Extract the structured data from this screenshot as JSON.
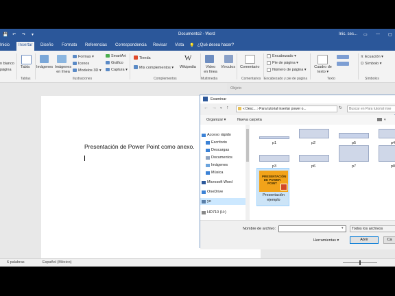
{
  "app": {
    "quick_access": [
      "💾",
      "↶",
      "↷"
    ],
    "doc_title": "Documento2 - Word",
    "user": "Inic. ses...",
    "window_buttons": [
      "▭",
      "—",
      "▢"
    ]
  },
  "tabs": [
    "Inicio",
    "Insertar",
    "Diseño",
    "Formato",
    "Referencias",
    "Correspondencia",
    "Revisar",
    "Vista",
    "¿Qué desea hacer?"
  ],
  "ribbon": {
    "pages_left": [
      "n blanco",
      "página"
    ],
    "table": "Tabla",
    "images": "Imágenes",
    "online_images": "Imágenes en línea",
    "shapes": "Formas ▾",
    "icons": "Iconos",
    "models3d": "Modelos 3D ▾",
    "smartart": "SmartArt",
    "chart": "Gráfico",
    "screenshot": "Captura ▾",
    "store": "Tienda",
    "my_addins": "Mis complementos ▾",
    "wikipedia": "Wikipedia",
    "video": "Vídeo en línea",
    "links": "Vínculos",
    "comment": "Comentario",
    "header": "Encabezado ▾",
    "footer": "Pie de página ▾",
    "page_number": "Número de página ▾",
    "textbox": "Cuadro de texto ▾",
    "equation": "Ecuación ▾",
    "symbol": "Símbolo ▾",
    "groups": {
      "pages": "Tablas",
      "tables": "Tablas",
      "illustrations": "Ilustraciones",
      "addins": "Complementos",
      "media": "Multimedia",
      "comments": "Comentarios",
      "header_footer": "Encabezado y pie de página",
      "text": "Texto",
      "symbols": "Símbolos"
    }
  },
  "document": {
    "line1": "Presentación de Power Point como anexo.",
    "objeto": "Objeto"
  },
  "status": {
    "words": "6 palabras",
    "lang": "Español (México)"
  },
  "dialog": {
    "title": "Examinar",
    "breadcrumb": "« Desc... › Para tutorial insertar power o...",
    "search_placeholder": "Buscar en Para tutorial inse",
    "organize": "Organizar ▾",
    "new_folder": "Nueva carpeta",
    "nav": [
      {
        "label": "Acceso rápido",
        "icon": "star-icon"
      },
      {
        "label": "Escritorio",
        "icon": "desktop-icon"
      },
      {
        "label": "Descargas",
        "icon": "download-icon"
      },
      {
        "label": "Documentos",
        "icon": "documents-icon"
      },
      {
        "label": "Imágenes",
        "icon": "pictures-icon"
      },
      {
        "label": "Música",
        "icon": "music-icon"
      },
      {
        "label": "Microsoft Word",
        "icon": "word-icon"
      },
      {
        "label": "OneDrive",
        "icon": "cloud-icon"
      },
      {
        "label": "yo",
        "icon": "pc-icon"
      },
      {
        "label": "HD710 (H:)",
        "icon": "drive-icon"
      }
    ],
    "files": [
      "p1",
      "p2",
      "p5",
      "p4",
      "p3",
      "p6",
      "p7",
      "p8",
      "Presentación ejemplo"
    ],
    "ppt_thumb_text": "PRESENTACIÓN DE POWER POINT",
    "filename_label": "Nombre de archivo:",
    "filename_value": "",
    "filter": "Todos los archivos",
    "tools": "Herramientas ▾",
    "open": "Abrir",
    "cancel": "Ca"
  },
  "colors": {
    "word_blue": "#2b579a",
    "ppt_orange": "#f2a31a",
    "ppt_red": "#d24726",
    "selection": "#cce4f7"
  }
}
